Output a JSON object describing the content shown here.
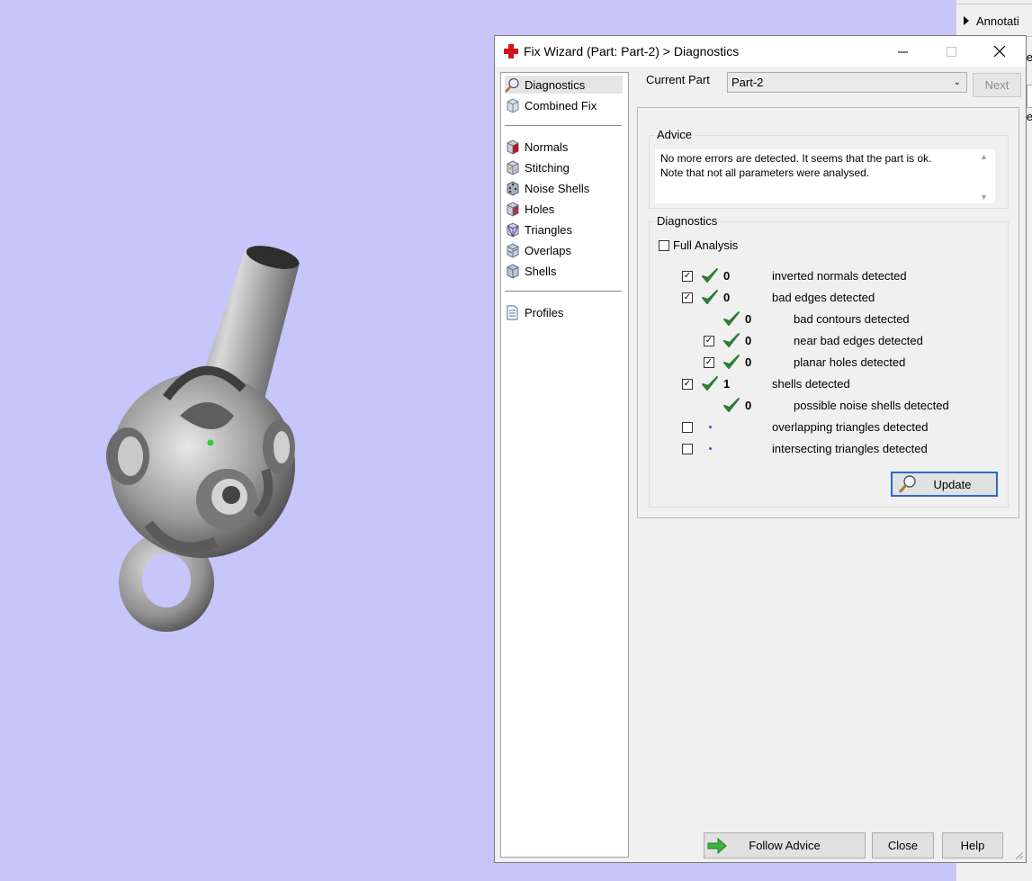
{
  "background_panel": {
    "annotation_label": "Annotati",
    "e1": "e",
    "e2": "e"
  },
  "dialog": {
    "title": "Fix Wizard (Part: Part-2) > Diagnostics",
    "window_controls": {
      "minimize": "—",
      "maximize": "☐",
      "close": "✕"
    }
  },
  "nav": {
    "items": [
      {
        "label": "Diagnostics",
        "icon": "magnifier-icon",
        "selected": true
      },
      {
        "label": "Combined Fix",
        "icon": "cube-icon"
      },
      {
        "label": "Normals",
        "icon": "normals-cube-icon"
      },
      {
        "label": "Stitching",
        "icon": "stitching-cube-icon"
      },
      {
        "label": "Noise Shells",
        "icon": "noise-cube-icon"
      },
      {
        "label": "Holes",
        "icon": "holes-cube-icon"
      },
      {
        "label": "Triangles",
        "icon": "triangles-cube-icon"
      },
      {
        "label": "Overlaps",
        "icon": "overlaps-cube-icon"
      },
      {
        "label": "Shells",
        "icon": "shells-cube-icon"
      },
      {
        "label": "Profiles",
        "icon": "document-icon"
      }
    ]
  },
  "current_part": {
    "label": "Current Part",
    "value": "Part-2"
  },
  "next_button": "Next",
  "advice": {
    "title": "Advice",
    "line1": "No more errors are detected. It seems that the part is ok.",
    "line2": "Note that not all parameters were analysed."
  },
  "diagnostics": {
    "title": "Diagnostics",
    "full_analysis_label": "Full Analysis",
    "full_analysis_checked": false,
    "rows": [
      {
        "label": "inverted normals detected",
        "count": "0",
        "checked": true,
        "status": "ok",
        "level": 0
      },
      {
        "label": "bad edges detected",
        "count": "0",
        "checked": true,
        "status": "ok",
        "level": 0
      },
      {
        "label": "bad contours detected",
        "count": "0",
        "checked": null,
        "status": "ok",
        "level": 1
      },
      {
        "label": "near bad edges detected",
        "count": "0",
        "checked": true,
        "status": "ok",
        "level": 1
      },
      {
        "label": "planar holes detected",
        "count": "0",
        "checked": true,
        "status": "ok",
        "level": 1
      },
      {
        "label": "shells detected",
        "count": "1",
        "checked": true,
        "status": "ok",
        "level": 0
      },
      {
        "label": "possible noise shells detected",
        "count": "0",
        "checked": null,
        "status": "ok",
        "level": 1
      },
      {
        "label": "overlapping triangles detected",
        "count": "",
        "checked": false,
        "status": "pending",
        "level": 0
      },
      {
        "label": "intersecting triangles detected",
        "count": "",
        "checked": false,
        "status": "pending",
        "level": 0
      }
    ],
    "update_button": "Update"
  },
  "buttons": {
    "follow_advice": "Follow Advice",
    "close": "Close",
    "help": "Help"
  },
  "colors": {
    "viewport_bg": "#c6c6fb",
    "check_green": "#2e7d32",
    "accent_blue": "#2a6bc4"
  }
}
